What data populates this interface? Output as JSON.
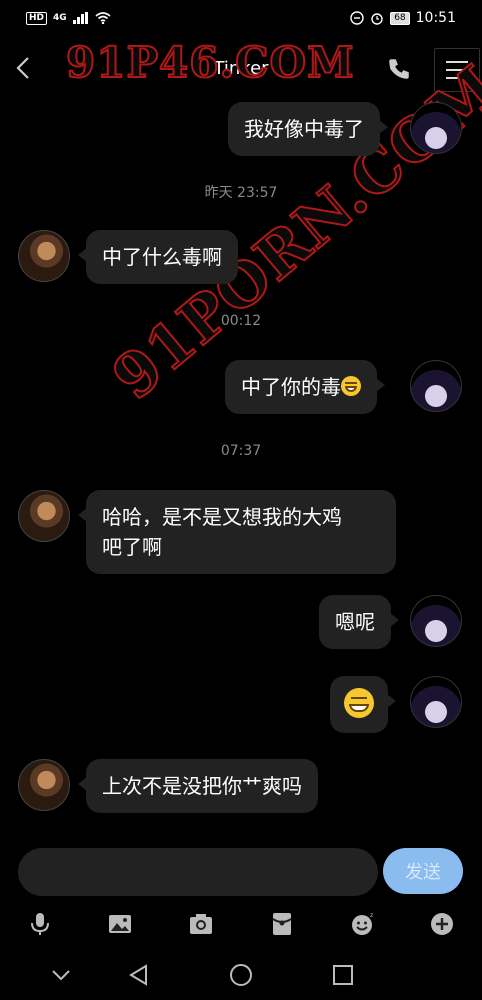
{
  "status_bar": {
    "hd": "HD",
    "network": "4G",
    "battery": "68",
    "time": "10:51"
  },
  "header": {
    "title": "Tinker"
  },
  "watermark": {
    "line1": "91P46.COM",
    "line2": "91PORN.COM"
  },
  "messages": [
    {
      "side": "self",
      "text": "我好像中毒了"
    },
    {
      "type": "timestamp",
      "text": "昨天 23:57"
    },
    {
      "side": "peer",
      "text": "中了什么毒啊"
    },
    {
      "type": "timestamp",
      "text": "00:12"
    },
    {
      "side": "self",
      "text": "中了你的毒",
      "emoji": "thinking-emoji"
    },
    {
      "type": "timestamp",
      "text": "07:37"
    },
    {
      "side": "peer",
      "text_line1": "哈哈，是不是又想我的大鸡",
      "text_line2": "吧了啊"
    },
    {
      "side": "self",
      "text": "嗯呢"
    },
    {
      "side": "self",
      "emoji": "grinning-emoji"
    },
    {
      "side": "peer",
      "text": "上次不是没把你艹爽吗"
    }
  ],
  "input": {
    "value": "",
    "send_label": "发送"
  },
  "toolbar": {
    "icons": [
      "microphone-icon",
      "image-icon",
      "camera-icon",
      "red-packet-icon",
      "emoji-icon",
      "add-icon"
    ]
  },
  "nav_bar": {
    "icons": [
      "collapse-icon",
      "back-triangle-icon",
      "home-circle-icon",
      "recents-square-icon"
    ]
  },
  "colors": {
    "background": "#000000",
    "bubble": "#222222",
    "send_button": "#8bbcf0",
    "timestamp": "#8a8a8a",
    "watermark_stroke": "#b01818"
  }
}
